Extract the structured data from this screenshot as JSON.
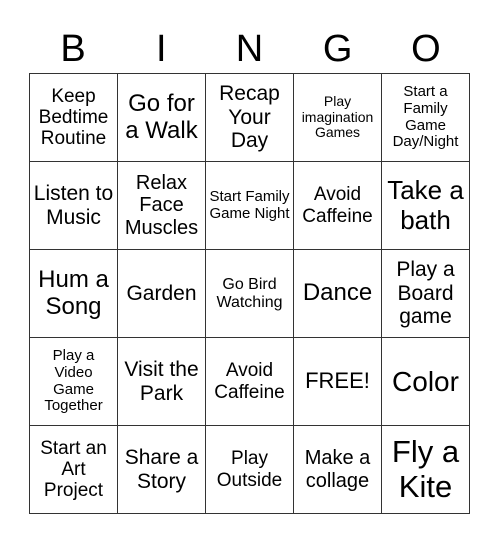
{
  "header": {
    "letters": [
      "B",
      "I",
      "N",
      "G",
      "O"
    ]
  },
  "grid": {
    "rows": [
      [
        "Keep Bedtime Routine",
        "Go for a Walk",
        "Recap Your Day",
        "Play imagination Games",
        "Start a Family Game Day/Night"
      ],
      [
        "Listen to Music",
        "Relax Face Muscles",
        "Start Family Game Night",
        "Avoid Caffeine",
        "Take a bath"
      ],
      [
        "Hum a Song",
        "Garden",
        "Go Bird Watching",
        "Dance",
        "Play a Board game"
      ],
      [
        "Play a Video Game Together",
        "Visit the Park",
        "Avoid Caffeine",
        "FREE!",
        "Color"
      ],
      [
        "Start an Art Project",
        "Share a Story",
        "Play Outside",
        "Make a collage",
        "Fly a Kite"
      ]
    ]
  }
}
